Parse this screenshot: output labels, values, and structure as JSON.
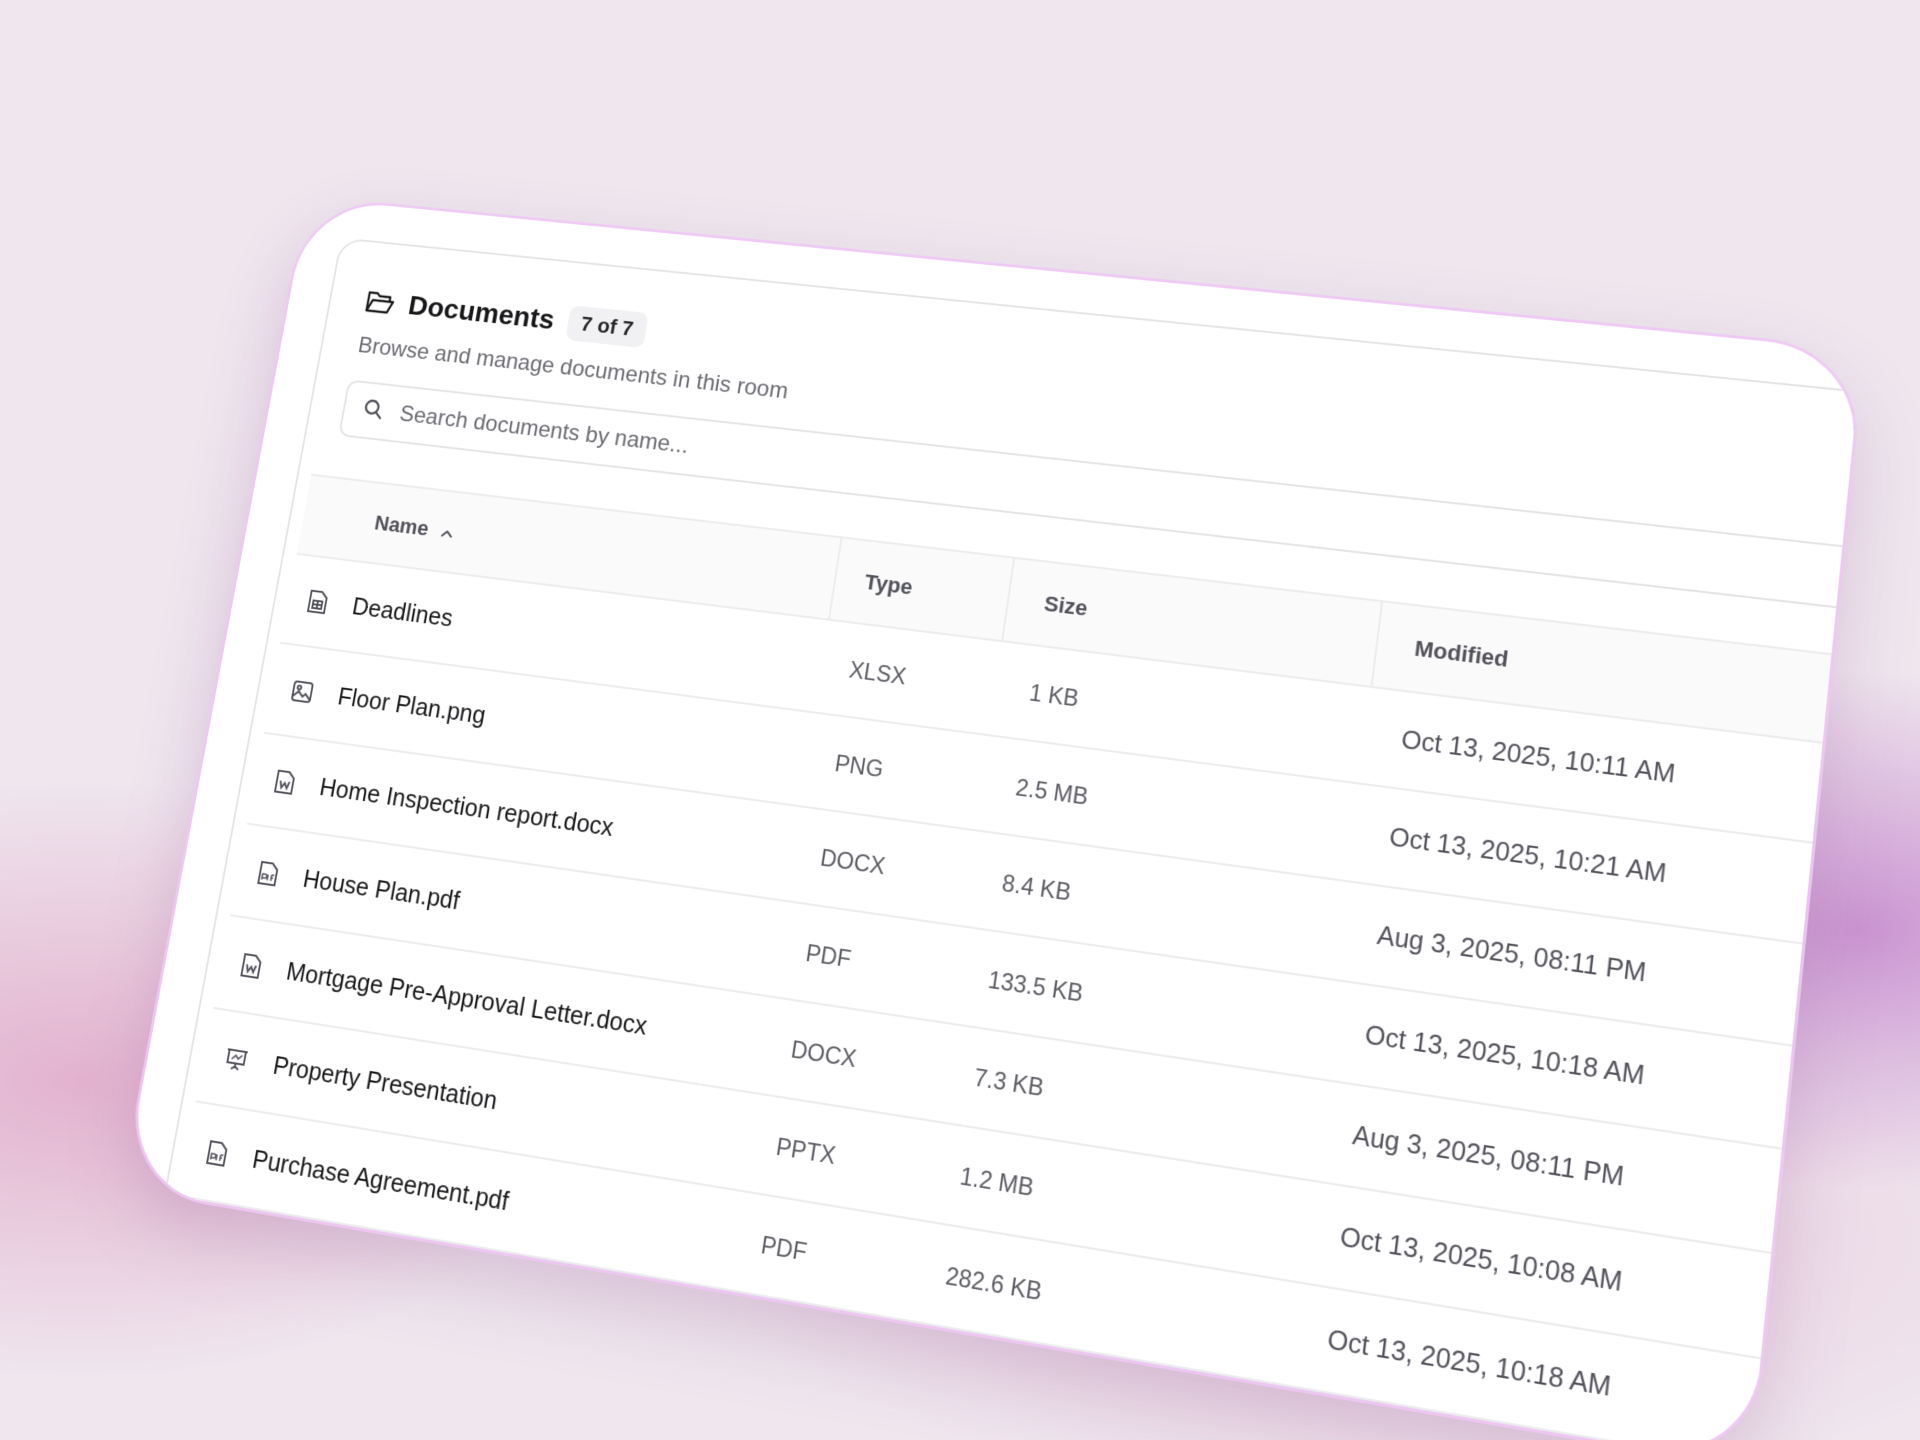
{
  "header": {
    "title": "Documents",
    "count_badge": "7 of 7",
    "subtitle": "Browse and manage documents in this room"
  },
  "search": {
    "placeholder": "Search documents by name..."
  },
  "table": {
    "columns": {
      "name": "Name",
      "type": "Type",
      "size": "Size",
      "modified": "Modified"
    },
    "sort_indicator": "^",
    "rows": [
      {
        "icon": "spreadsheet-icon",
        "name": "Deadlines",
        "type": "XLSX",
        "size": "1 KB",
        "modified": "Oct 13, 2025, 10:11 AM"
      },
      {
        "icon": "image-icon",
        "name": "Floor Plan.png",
        "type": "PNG",
        "size": "2.5 MB",
        "modified": "Oct 13, 2025, 10:21 AM"
      },
      {
        "icon": "word-doc-icon",
        "name": "Home Inspection report.docx",
        "type": "DOCX",
        "size": "8.4 KB",
        "modified": "Aug 3, 2025, 08:11 PM"
      },
      {
        "icon": "pdf-icon",
        "name": "House Plan.pdf",
        "type": "PDF",
        "size": "133.5 KB",
        "modified": "Oct 13, 2025, 10:18 AM"
      },
      {
        "icon": "word-doc-icon",
        "name": "Mortgage Pre-Approval Letter.docx",
        "type": "DOCX",
        "size": "7.3 KB",
        "modified": "Aug 3, 2025, 08:11 PM"
      },
      {
        "icon": "presentation-icon",
        "name": "Property Presentation",
        "type": "PPTX",
        "size": "1.2 MB",
        "modified": "Oct 13, 2025, 10:08 AM"
      },
      {
        "icon": "pdf-icon",
        "name": "Purchase Agreement.pdf",
        "type": "PDF",
        "size": "282.6 KB",
        "modified": "Oct 13, 2025, 10:18 AM"
      }
    ]
  }
}
